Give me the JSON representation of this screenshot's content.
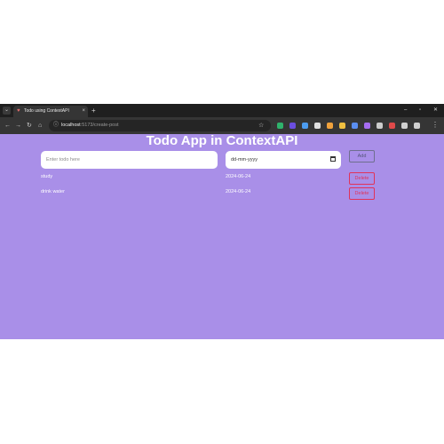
{
  "browser": {
    "tab_title": "Todo using ContextAPI",
    "tab_close": "×",
    "new_tab": "+",
    "url_host": "localhost",
    "url_rest": ":5173/create-post",
    "win_min": "–",
    "win_max": "▫",
    "win_close": "✕",
    "extension_colors": [
      "#2fb36c",
      "#6b4ee0",
      "#4c9cf0",
      "#e0e0e0",
      "#f0a23c",
      "#f0c040",
      "#5a8ef0",
      "#a56cf0",
      "#cccccc",
      "#e04a4a",
      "#d0d0d0",
      "#d0d0d0"
    ]
  },
  "app": {
    "title": "Todo App in ContextAPI",
    "todo_placeholder": "Enter todo here",
    "date_placeholder": "dd-mm-yyyy",
    "add_label": "Add",
    "todos": [
      {
        "name": "study",
        "date": "2024-06-24",
        "delete_label": "Delete"
      },
      {
        "name": "drink water",
        "date": "2024-06-24",
        "delete_label": "Delete"
      }
    ]
  },
  "colors": {
    "background": "#a98fe8",
    "accent_delete": "#e0335a",
    "chrome_dark": "#1f1f1f"
  }
}
